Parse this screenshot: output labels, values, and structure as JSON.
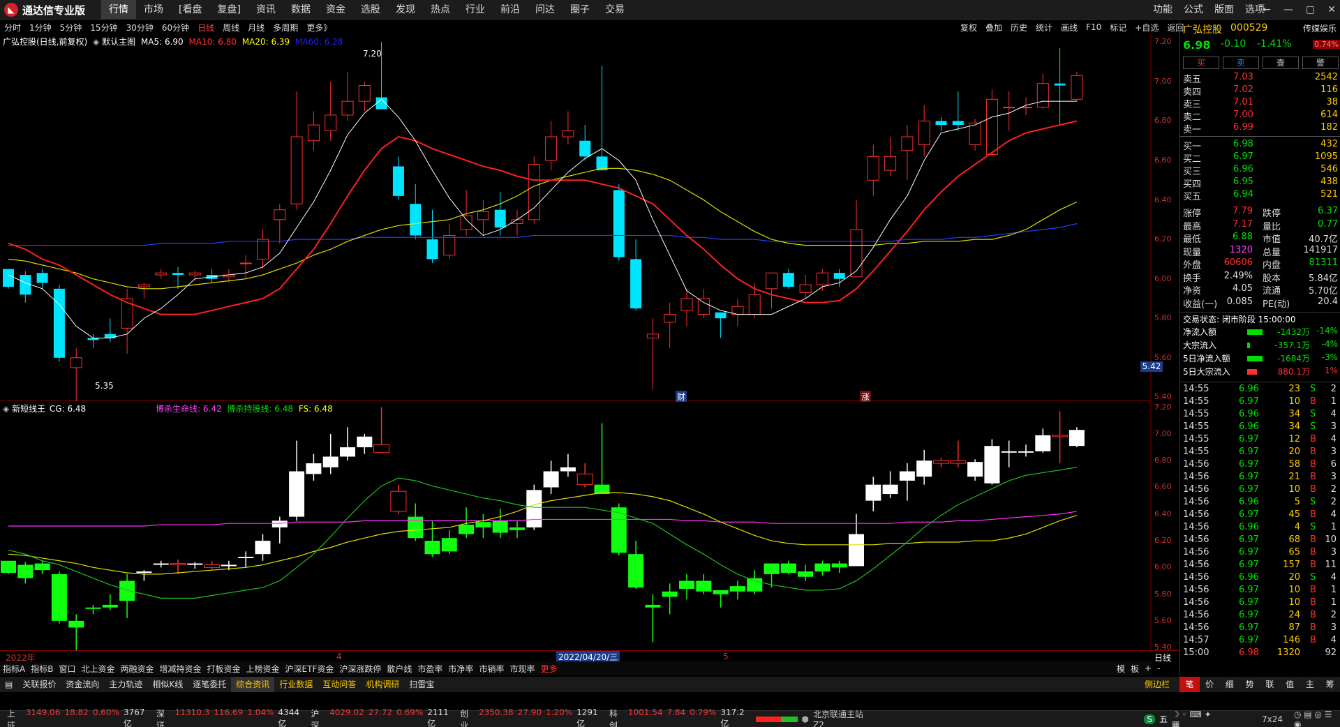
{
  "app": {
    "name": "通达信专业版",
    "logo_icon": "tdx-logo-icon"
  },
  "menu": [
    "行情",
    "市场",
    "[看盘",
    "复盘]",
    "资讯",
    "数据",
    "资金",
    "选股",
    "发现",
    "热点",
    "行业",
    "前沿",
    "问达",
    "圈子",
    "交易"
  ],
  "menu_active": 0,
  "right_menu": [
    "功能",
    "公式",
    "版面",
    "选项"
  ],
  "window_buttons": {
    "back": "←",
    "min": "—",
    "restore": "▢",
    "close": "✕"
  },
  "periods": [
    "分时",
    "1分钟",
    "5分钟",
    "15分钟",
    "30分钟",
    "60分钟",
    "日线",
    "周线",
    "月线",
    "多周期",
    "更多》"
  ],
  "period_active": 6,
  "toolbar": [
    "复权",
    "叠加",
    "历史",
    "统计",
    "画线",
    "F10",
    "标记",
    "+自选",
    "返回"
  ],
  "main_legend": {
    "title": "广弘控股(日线,前复权)",
    "view": "默认主图",
    "ma5": "MA5: 6.90",
    "ma10": "MA10: 6.80",
    "ma20": "MA20: 6.39",
    "ma60": "MA60: 6.28"
  },
  "main_annotations": {
    "high": "7.20",
    "low": "5.35",
    "price_tag": "5.42",
    "fin_badge": "财",
    "zhang_badge": "涨"
  },
  "sub_legend": {
    "title": "新短线王",
    "cg": "CG: 6.48",
    "bsl": "博杀生命线: 6.42",
    "bsc": "博杀持股线: 6.48",
    "fs": "FS: 6.48"
  },
  "axis_labels": [
    "7.20",
    "7.00",
    "6.80",
    "6.60",
    "6.40",
    "6.20",
    "6.00",
    "5.80",
    "5.60",
    "5.40"
  ],
  "date_axis": {
    "start": "2022年",
    "m4": "4",
    "cursor": "2022/04/20/三",
    "m5": "5",
    "period": "日线"
  },
  "colors": {
    "up": "#ff3030",
    "down": "#00e5ff",
    "ma5": "#ffffff",
    "ma10": "#ff2020",
    "ma20": "#e0e000",
    "ma60": "#2040ff",
    "sub_up": "#ffffff",
    "sub_down": "#10ff10",
    "sub_bsl": "#ff30ff",
    "sub_yellow": "#e0e000",
    "sub_green": "#20c020"
  },
  "chart_data": {
    "type": "candlestick",
    "ylim": [
      5.4,
      7.2
    ],
    "ma5_last": 6.9,
    "ma10_last": 6.8,
    "ma20_last": 6.39,
    "ma60_last": 6.28,
    "candles": [
      [
        6.05,
        5.96,
        6.05,
        5.95
      ],
      [
        6.02,
        5.92,
        6.04,
        5.88
      ],
      [
        6.03,
        5.98,
        6.05,
        5.95
      ],
      [
        5.95,
        5.6,
        5.97,
        5.58
      ],
      [
        5.55,
        5.6,
        5.65,
        5.35
      ],
      [
        5.7,
        5.69,
        5.72,
        5.65
      ],
      [
        5.72,
        5.7,
        5.8,
        5.68
      ],
      [
        5.75,
        5.9,
        5.95,
        5.62
      ],
      [
        5.96,
        5.97,
        5.98,
        5.9
      ],
      [
        6.02,
        6.03,
        6.05,
        6.0
      ],
      [
        6.03,
        6.02,
        6.06,
        5.95
      ],
      [
        6.02,
        6.03,
        6.04,
        5.99
      ],
      [
        6.02,
        6.0,
        6.05,
        5.98
      ],
      [
        6.01,
        6.02,
        6.05,
        5.98
      ],
      [
        6.08,
        6.08,
        6.12,
        6.0
      ],
      [
        6.1,
        6.2,
        6.25,
        6.05
      ],
      [
        6.3,
        6.35,
        6.38,
        6.18
      ],
      [
        6.38,
        6.72,
        6.95,
        6.35
      ],
      [
        6.7,
        6.78,
        6.85,
        6.65
      ],
      [
        6.75,
        6.83,
        7.0,
        6.7
      ],
      [
        6.83,
        6.9,
        7.05,
        6.8
      ],
      [
        6.9,
        6.98,
        7.0,
        6.85
      ],
      [
        6.92,
        6.86,
        7.2,
        6.86
      ],
      [
        6.57,
        6.42,
        6.62,
        6.4
      ],
      [
        6.38,
        6.22,
        6.48,
        6.2
      ],
      [
        6.2,
        6.1,
        6.35,
        6.08
      ],
      [
        6.12,
        6.22,
        6.28,
        6.1
      ],
      [
        6.25,
        6.32,
        6.45,
        6.22
      ],
      [
        6.3,
        6.34,
        6.4,
        6.22
      ],
      [
        6.35,
        6.26,
        6.44,
        6.22
      ],
      [
        6.28,
        6.3,
        6.35,
        6.22
      ],
      [
        6.3,
        6.58,
        6.62,
        6.28
      ],
      [
        6.6,
        6.72,
        6.8,
        6.55
      ],
      [
        6.72,
        6.75,
        6.85,
        6.68
      ],
      [
        6.7,
        6.62,
        6.78,
        6.6
      ],
      [
        6.62,
        6.55,
        7.08,
        6.55
      ],
      [
        6.45,
        6.11,
        6.48,
        6.09
      ],
      [
        6.1,
        5.85,
        6.2,
        5.84
      ],
      [
        5.7,
        5.72,
        5.8,
        5.44
      ],
      [
        5.78,
        5.82,
        5.88,
        5.65
      ],
      [
        5.84,
        5.9,
        5.95,
        5.76
      ],
      [
        5.82,
        5.9,
        5.95,
        5.8
      ],
      [
        5.83,
        5.8,
        5.83,
        5.7
      ],
      [
        5.82,
        5.86,
        5.9,
        5.76
      ],
      [
        5.82,
        5.92,
        5.98,
        5.8
      ],
      [
        5.95,
        6.03,
        6.03,
        5.85
      ],
      [
        6.03,
        5.96,
        6.05,
        5.95
      ],
      [
        5.93,
        5.97,
        6.02,
        5.9
      ],
      [
        5.97,
        6.03,
        6.05,
        5.94
      ],
      [
        6.03,
        6.0,
        6.05,
        5.96
      ],
      [
        6.01,
        6.25,
        6.4,
        6.02
      ],
      [
        6.5,
        6.62,
        6.68,
        6.42
      ],
      [
        6.55,
        6.62,
        6.72,
        6.52
      ],
      [
        6.65,
        6.72,
        6.78,
        6.5
      ],
      [
        6.68,
        6.8,
        6.88,
        6.62
      ],
      [
        6.8,
        6.78,
        6.82,
        6.75
      ],
      [
        6.8,
        6.78,
        6.95,
        6.75
      ],
      [
        6.68,
        6.79,
        6.81,
        6.65
      ],
      [
        6.63,
        6.91,
        6.96,
        6.62
      ],
      [
        6.87,
        6.87,
        6.95,
        6.75
      ],
      [
        6.87,
        6.87,
        6.92,
        6.83
      ],
      [
        6.87,
        6.99,
        7.04,
        6.86
      ],
      [
        6.99,
        6.98,
        7.17,
        6.78
      ],
      [
        6.91,
        7.03,
        7.05,
        6.9
      ]
    ],
    "ma5": [
      6.02,
      5.98,
      5.95,
      5.87,
      5.76,
      5.7,
      5.7,
      5.72,
      5.8,
      5.85,
      5.92,
      6.0,
      6.01,
      6.02,
      6.03,
      6.06,
      6.13,
      6.26,
      6.39,
      6.55,
      6.73,
      6.84,
      6.91,
      6.82,
      6.7,
      6.55,
      6.41,
      6.3,
      6.22,
      6.25,
      6.3,
      6.36,
      6.45,
      6.54,
      6.61,
      6.66,
      6.6,
      6.5,
      6.3,
      6.12,
      5.94,
      5.88,
      5.84,
      5.82,
      5.82,
      5.82,
      5.86,
      5.9,
      5.96,
      5.98,
      6.04,
      6.16,
      6.3,
      6.42,
      6.6,
      6.74,
      6.76,
      6.78,
      6.82,
      6.84,
      6.88,
      6.9,
      6.9,
      6.9
    ],
    "ma10": [
      6.18,
      6.15,
      6.1,
      6.07,
      6.02,
      5.97,
      5.92,
      5.88,
      5.85,
      5.82,
      5.82,
      5.82,
      5.84,
      5.86,
      5.88,
      5.9,
      5.95,
      6.05,
      6.15,
      6.28,
      6.42,
      6.55,
      6.66,
      6.72,
      6.7,
      6.66,
      6.63,
      6.6,
      6.57,
      6.55,
      6.52,
      6.5,
      6.5,
      6.5,
      6.5,
      6.48,
      6.46,
      6.42,
      6.38,
      6.3,
      6.22,
      6.15,
      6.07,
      6.0,
      5.95,
      5.92,
      5.9,
      5.88,
      5.88,
      5.89,
      5.95,
      6.04,
      6.14,
      6.24,
      6.35,
      6.44,
      6.52,
      6.58,
      6.64,
      6.7,
      6.74,
      6.76,
      6.78,
      6.8
    ],
    "ma20": [
      6.1,
      6.09,
      6.07,
      6.05,
      6.03,
      6.0,
      5.98,
      5.96,
      5.95,
      5.95,
      5.96,
      5.97,
      5.98,
      5.99,
      6.0,
      6.02,
      6.05,
      6.08,
      6.12,
      6.15,
      6.19,
      6.22,
      6.25,
      6.27,
      6.28,
      6.29,
      6.3,
      6.33,
      6.35,
      6.38,
      6.42,
      6.47,
      6.5,
      6.52,
      6.54,
      6.56,
      6.56,
      6.55,
      6.53,
      6.5,
      6.45,
      6.4,
      6.34,
      6.29,
      6.24,
      6.2,
      6.18,
      6.17,
      6.17,
      6.17,
      6.17,
      6.17,
      6.18,
      6.18,
      6.19,
      6.19,
      6.19,
      6.2,
      6.2,
      6.22,
      6.25,
      6.3,
      6.35,
      6.39
    ],
    "ma60": [
      6.17,
      6.17,
      6.17,
      6.17,
      6.17,
      6.17,
      6.17,
      6.17,
      6.17,
      6.18,
      6.18,
      6.18,
      6.18,
      6.19,
      6.19,
      6.19,
      6.19,
      6.2,
      6.2,
      6.2,
      6.2,
      6.21,
      6.21,
      6.21,
      6.21,
      6.21,
      6.21,
      6.21,
      6.21,
      6.21,
      6.21,
      6.22,
      6.22,
      6.22,
      6.22,
      6.22,
      6.22,
      6.22,
      6.22,
      6.22,
      6.21,
      6.21,
      6.2,
      6.2,
      6.2,
      6.19,
      6.19,
      6.19,
      6.19,
      6.19,
      6.19,
      6.19,
      6.19,
      6.2,
      6.2,
      6.2,
      6.21,
      6.21,
      6.22,
      6.23,
      6.24,
      6.25,
      6.26,
      6.28
    ]
  },
  "quote": {
    "name": "广弘控股",
    "code": "000529",
    "tag": "传媒娱乐",
    "price": "6.98",
    "change": "-0.10",
    "pct": "-1.41%",
    "turnover_badge": "0.74%"
  },
  "trade_buttons": [
    "买",
    "卖",
    "查",
    "警"
  ],
  "order_book": {
    "sell": [
      [
        "卖五",
        "7.03",
        "2542"
      ],
      [
        "卖四",
        "7.02",
        "116"
      ],
      [
        "卖三",
        "7.01",
        "38"
      ],
      [
        "卖二",
        "7.00",
        "614"
      ],
      [
        "卖一",
        "6.99",
        "182"
      ]
    ],
    "buy": [
      [
        "买一",
        "6.98",
        "432"
      ],
      [
        "买二",
        "6.97",
        "1095"
      ],
      [
        "买三",
        "6.96",
        "546"
      ],
      [
        "买四",
        "6.95",
        "438"
      ],
      [
        "买五",
        "6.94",
        "521"
      ]
    ]
  },
  "stats": [
    [
      "涨停",
      "7.79",
      "跌停",
      "6.37"
    ],
    [
      "最高",
      "7.17",
      "量比",
      "0.77"
    ],
    [
      "最低",
      "6.88",
      "市值",
      "40.7亿"
    ],
    [
      "现量",
      "1320",
      "总量",
      "141917"
    ],
    [
      "外盘",
      "60606",
      "内盘",
      "81311"
    ],
    [
      "换手",
      "2.49%",
      "股本",
      "5.84亿"
    ],
    [
      "净资",
      "4.05",
      "流通",
      "5.70亿"
    ],
    [
      "收益(一)",
      "0.085",
      "PE(动)",
      "20.4"
    ]
  ],
  "trade_status": "交易状态: 闭市阶段 15:00:00",
  "flows": [
    [
      "净流入额",
      "-1432万",
      "-14%"
    ],
    [
      "大宗流入",
      "-357.1万",
      "-4%"
    ],
    [
      "5日净流入额",
      "-1684万",
      "-3%"
    ],
    [
      "5日大宗流入",
      "880.1万",
      "1%"
    ]
  ],
  "ticks": [
    [
      "14:55",
      "6.96",
      "23",
      "S",
      "2"
    ],
    [
      "14:55",
      "6.97",
      "10",
      "B",
      "1"
    ],
    [
      "14:55",
      "6.96",
      "34",
      "S",
      "4"
    ],
    [
      "14:55",
      "6.96",
      "34",
      "S",
      "3"
    ],
    [
      "14:55",
      "6.97",
      "12",
      "B",
      "4"
    ],
    [
      "14:55",
      "6.97",
      "20",
      "B",
      "3"
    ],
    [
      "14:56",
      "6.97",
      "58",
      "B",
      "6"
    ],
    [
      "14:56",
      "6.97",
      "21",
      "B",
      "3"
    ],
    [
      "14:56",
      "6.97",
      "10",
      "B",
      "2"
    ],
    [
      "14:56",
      "6.96",
      "5",
      "S",
      "2"
    ],
    [
      "14:56",
      "6.97",
      "45",
      "B",
      "4"
    ],
    [
      "14:56",
      "6.96",
      "4",
      "S",
      "1"
    ],
    [
      "14:56",
      "6.97",
      "68",
      "B",
      "10"
    ],
    [
      "14:56",
      "6.97",
      "65",
      "B",
      "3"
    ],
    [
      "14:56",
      "6.97",
      "157",
      "B",
      "11"
    ],
    [
      "14:56",
      "6.96",
      "20",
      "S",
      "4"
    ],
    [
      "14:56",
      "6.97",
      "10",
      "B",
      "1"
    ],
    [
      "14:56",
      "6.97",
      "10",
      "B",
      "1"
    ],
    [
      "14:56",
      "6.97",
      "24",
      "B",
      "2"
    ],
    [
      "14:56",
      "6.97",
      "87",
      "B",
      "3"
    ],
    [
      "14:57",
      "6.97",
      "146",
      "B",
      "4"
    ],
    [
      "15:00",
      "6.98",
      "1320",
      "",
      "92"
    ]
  ],
  "indicator_tabs": [
    "指标A",
    "指标B",
    "窗口",
    "北上资金",
    "两融资金",
    "增减持资金",
    "打板资金",
    "上榜资金",
    "沪深ETF资金",
    "沪深涨跌停",
    "散户线",
    "市盈率",
    "市净率",
    "市销率",
    "市现率",
    "更多"
  ],
  "indicator_tabs_right": [
    "模",
    "板",
    "+",
    "-"
  ],
  "bottom_tabs": [
    "关联报价",
    "资金流向",
    "主力轨迹",
    "相似K线",
    "逐笔委托",
    "综合资讯",
    "行业数据",
    "互动问答",
    "机构调研",
    "扫雷宝"
  ],
  "bottom_tabs_right": "侧边栏",
  "panel_tabs": [
    "笔",
    "价",
    "细",
    "势",
    "联",
    "值",
    "主",
    "筹"
  ],
  "status": {
    "items": [
      [
        "上证",
        "3149.06",
        "18.82",
        "0.60%",
        "3767亿"
      ],
      [
        "深证",
        "11310.3",
        "116.69",
        "1.04%",
        "4344亿"
      ],
      [
        "沪深",
        "4029.02",
        "27.72",
        "0.69%",
        "2111亿"
      ],
      [
        "创业",
        "2350.38",
        "27.90",
        "1.20%",
        "1291亿"
      ],
      [
        "科创",
        "1001.54",
        "7.84",
        "0.79%",
        "317.2亿"
      ]
    ],
    "server": "北京联通主站Z2",
    "clock": "7x24",
    "ime": "五"
  }
}
